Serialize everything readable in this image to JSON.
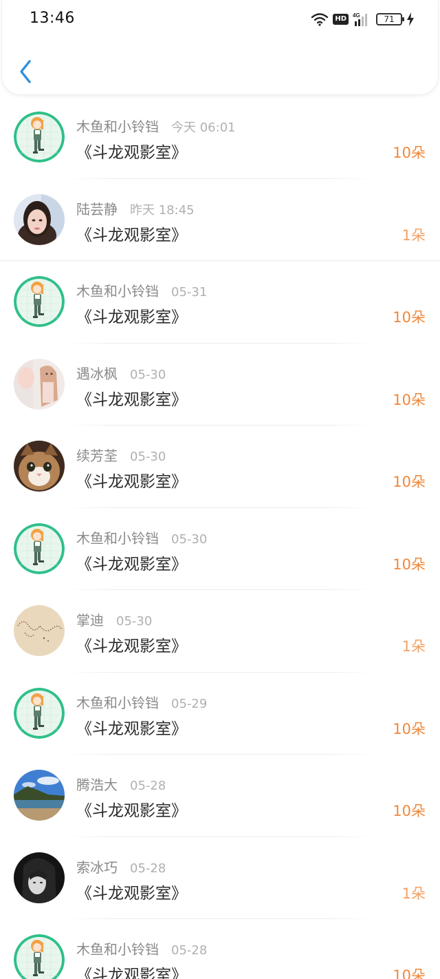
{
  "status_bar": {
    "time": "13:46",
    "battery": "71",
    "network": "4G",
    "hd": "HD"
  },
  "header": {
    "back_icon": "chevron-left-icon"
  },
  "accent_color": "#f0883a",
  "items": [
    {
      "name": "木鱼和小铃铛",
      "time": "今天 06:01",
      "title": "《斗龙观影室》",
      "amount": "10朵",
      "avatar": "anime-girl"
    },
    {
      "name": "陆芸静",
      "time": "昨天 18:45",
      "title": "《斗龙观影室》",
      "amount": "1朵",
      "avatar": "woman-portrait"
    },
    {
      "name": "木鱼和小铃铛",
      "time": "05-31",
      "title": "《斗龙观影室》",
      "amount": "10朵",
      "avatar": "anime-girl"
    },
    {
      "name": "遇冰枫",
      "time": "05-30",
      "title": "《斗龙观影室》",
      "amount": "10朵",
      "avatar": "woman-photo"
    },
    {
      "name": "续芳荃",
      "time": "05-30",
      "title": "《斗龙观影室》",
      "amount": "10朵",
      "avatar": "cat"
    },
    {
      "name": "木鱼和小铃铛",
      "time": "05-30",
      "title": "《斗龙观影室》",
      "amount": "10朵",
      "avatar": "anime-girl"
    },
    {
      "name": "掌迪",
      "time": "05-30",
      "title": "《斗龙观影室》",
      "amount": "1朵",
      "avatar": "sand-beads"
    },
    {
      "name": "木鱼和小铃铛",
      "time": "05-29",
      "title": "《斗龙观影室》",
      "amount": "10朵",
      "avatar": "anime-girl"
    },
    {
      "name": "腾浩大",
      "time": "05-28",
      "title": "《斗龙观影室》",
      "amount": "10朵",
      "avatar": "beach-landscape"
    },
    {
      "name": "索冰巧",
      "time": "05-28",
      "title": "《斗龙观影室》",
      "amount": "1朵",
      "avatar": "dark-portrait"
    },
    {
      "name": "木鱼和小铃铛",
      "time": "05-28",
      "title": "《斗龙观影室》",
      "amount": "10朵",
      "avatar": "anime-girl"
    }
  ]
}
